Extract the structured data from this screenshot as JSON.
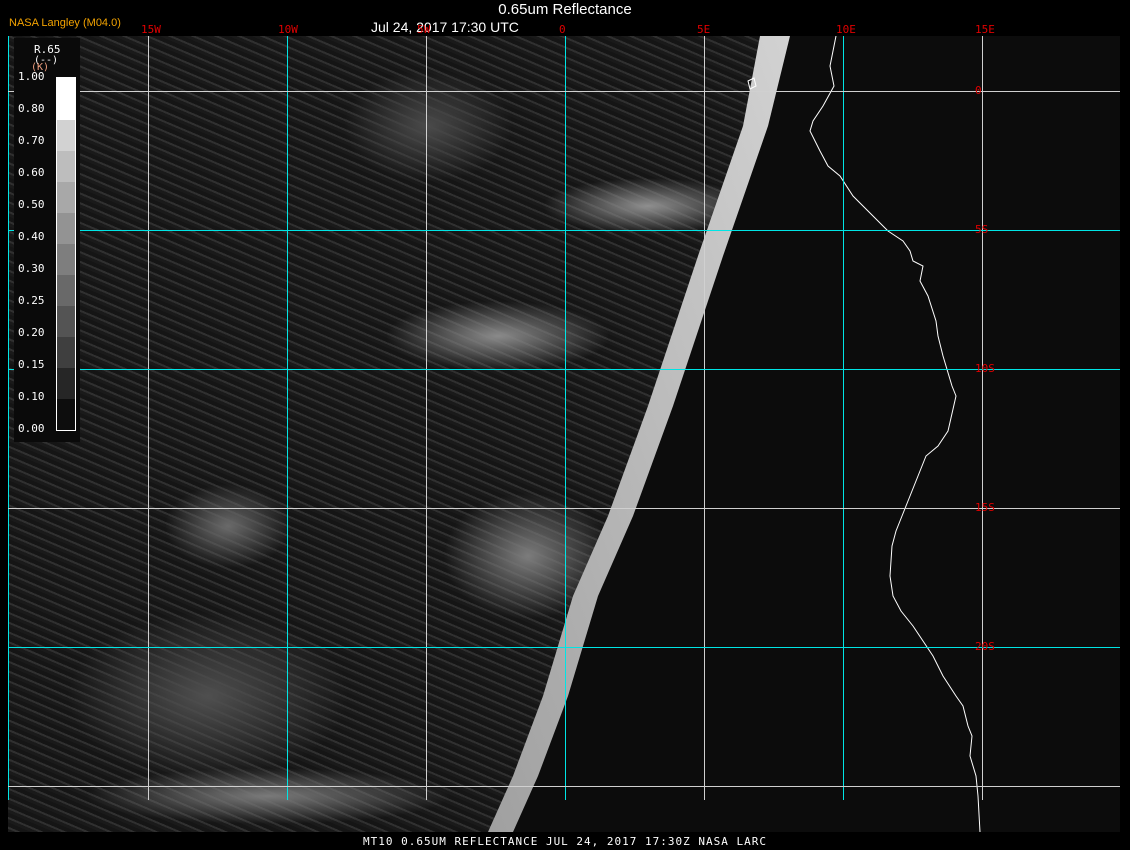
{
  "header": {
    "title": "0.65um Reflectance",
    "subtitle": "Jul 24, 2017 17:30 UTC",
    "brand": "NASA Langley (M04.0)"
  },
  "grid": {
    "longitudes": [
      "15W",
      "10W",
      "5W",
      "0",
      "5E",
      "10E",
      "15E"
    ],
    "latitudes": [
      "0",
      "5S",
      "10S",
      "15S",
      "20S"
    ],
    "colors": {
      "gridline_cyan": "#00e5e5",
      "gridline_white": "#d0d0d0",
      "label": "#e00000"
    }
  },
  "legend": {
    "title": "R.65",
    "unit": "(--)",
    "unit_marker": "(K)",
    "ticks": [
      "1.00",
      "0.80",
      "0.70",
      "0.60",
      "0.50",
      "0.40",
      "0.30",
      "0.25",
      "0.20",
      "0.15",
      "0.10",
      "0.00"
    ],
    "colors": [
      "#ffffff",
      "#e6e6e6",
      "#d2d2d2",
      "#bdbdbd",
      "#a8a8a8",
      "#939393",
      "#7e7e7e",
      "#696969",
      "#545454",
      "#3f3f3f",
      "#262626",
      "#0d0d0d"
    ]
  },
  "footer": {
    "text": "MT10  0.65UM REFLECTANCE   JUL 24, 2017 17:30Z   NASA LARC"
  }
}
